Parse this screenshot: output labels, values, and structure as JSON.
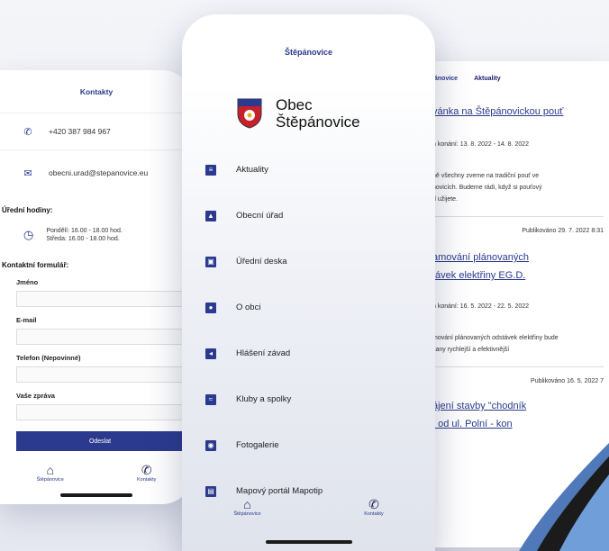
{
  "left_screen": {
    "title": "Kontakty",
    "phone": "+420 387 984 967",
    "email": "obecni.urad@stepanovice.eu",
    "hours_heading": "Úřední hodiny:",
    "hours_line1": "Pondělí: 16.00 - 18.00 hod.",
    "hours_line2": "Středa: 16.00 - 18.00 hod.",
    "form_heading": "Kontaktní formulář:",
    "fields": [
      "Jméno",
      "E-mail",
      "Telefon (Nepovinné)",
      "Vaše zpráva"
    ],
    "send_label": "Odeslat",
    "nav": [
      "Štěpánovice",
      "Kontakty"
    ]
  },
  "center_screen": {
    "title": "Štěpánovice",
    "brand_line1": "Obec",
    "brand_line2": "Štěpánovice",
    "menu": [
      "Aktuality",
      "Obecní úřad",
      "Úřední deska",
      "O obci",
      "Hlášení závad",
      "Kluby a spolky",
      "Fotogalerie",
      "Mapový portál Mapotip"
    ],
    "nav": [
      "Štěpánovice",
      "Kontakty"
    ]
  },
  "right_screen": {
    "tab_back": "ánovice",
    "tab_active": "Aktuality",
    "article1_title": "vánka na Štěpánovickou pouť",
    "article1_date": "n konání: 13. 8. 2022 - 14. 8. 2022",
    "article1_text1": "ně všechny zveme na tradiční pouť ve",
    "article1_text2": "novicích. Budeme rádi, když si pouťový",
    "article1_text3": "d užijete.",
    "published1": "Publikováno 29. 7. 2022 8:31",
    "article2_title1": "amování plánovaných",
    "article2_title2": "távek elektřiny EG.D.",
    "article2_date": "n konání: 16. 5. 2022 - 22. 5. 2022",
    "article2_text1": "mování plánovaných odstávek elektřiny bude",
    "article2_text2": "čany rychlejší a efektivnější",
    "published2": "Publikováno 16. 5. 2022 7",
    "article3_title1": "ájení stavby \"chodník",
    "article3_title2": ". od ul. Polní - kon"
  },
  "colors": {
    "accent": "#2b3a8e",
    "background": "#e9ebf3"
  },
  "icons": [
    "phone-icon",
    "mail-icon",
    "clock-icon",
    "home-icon",
    "menu-icon"
  ]
}
